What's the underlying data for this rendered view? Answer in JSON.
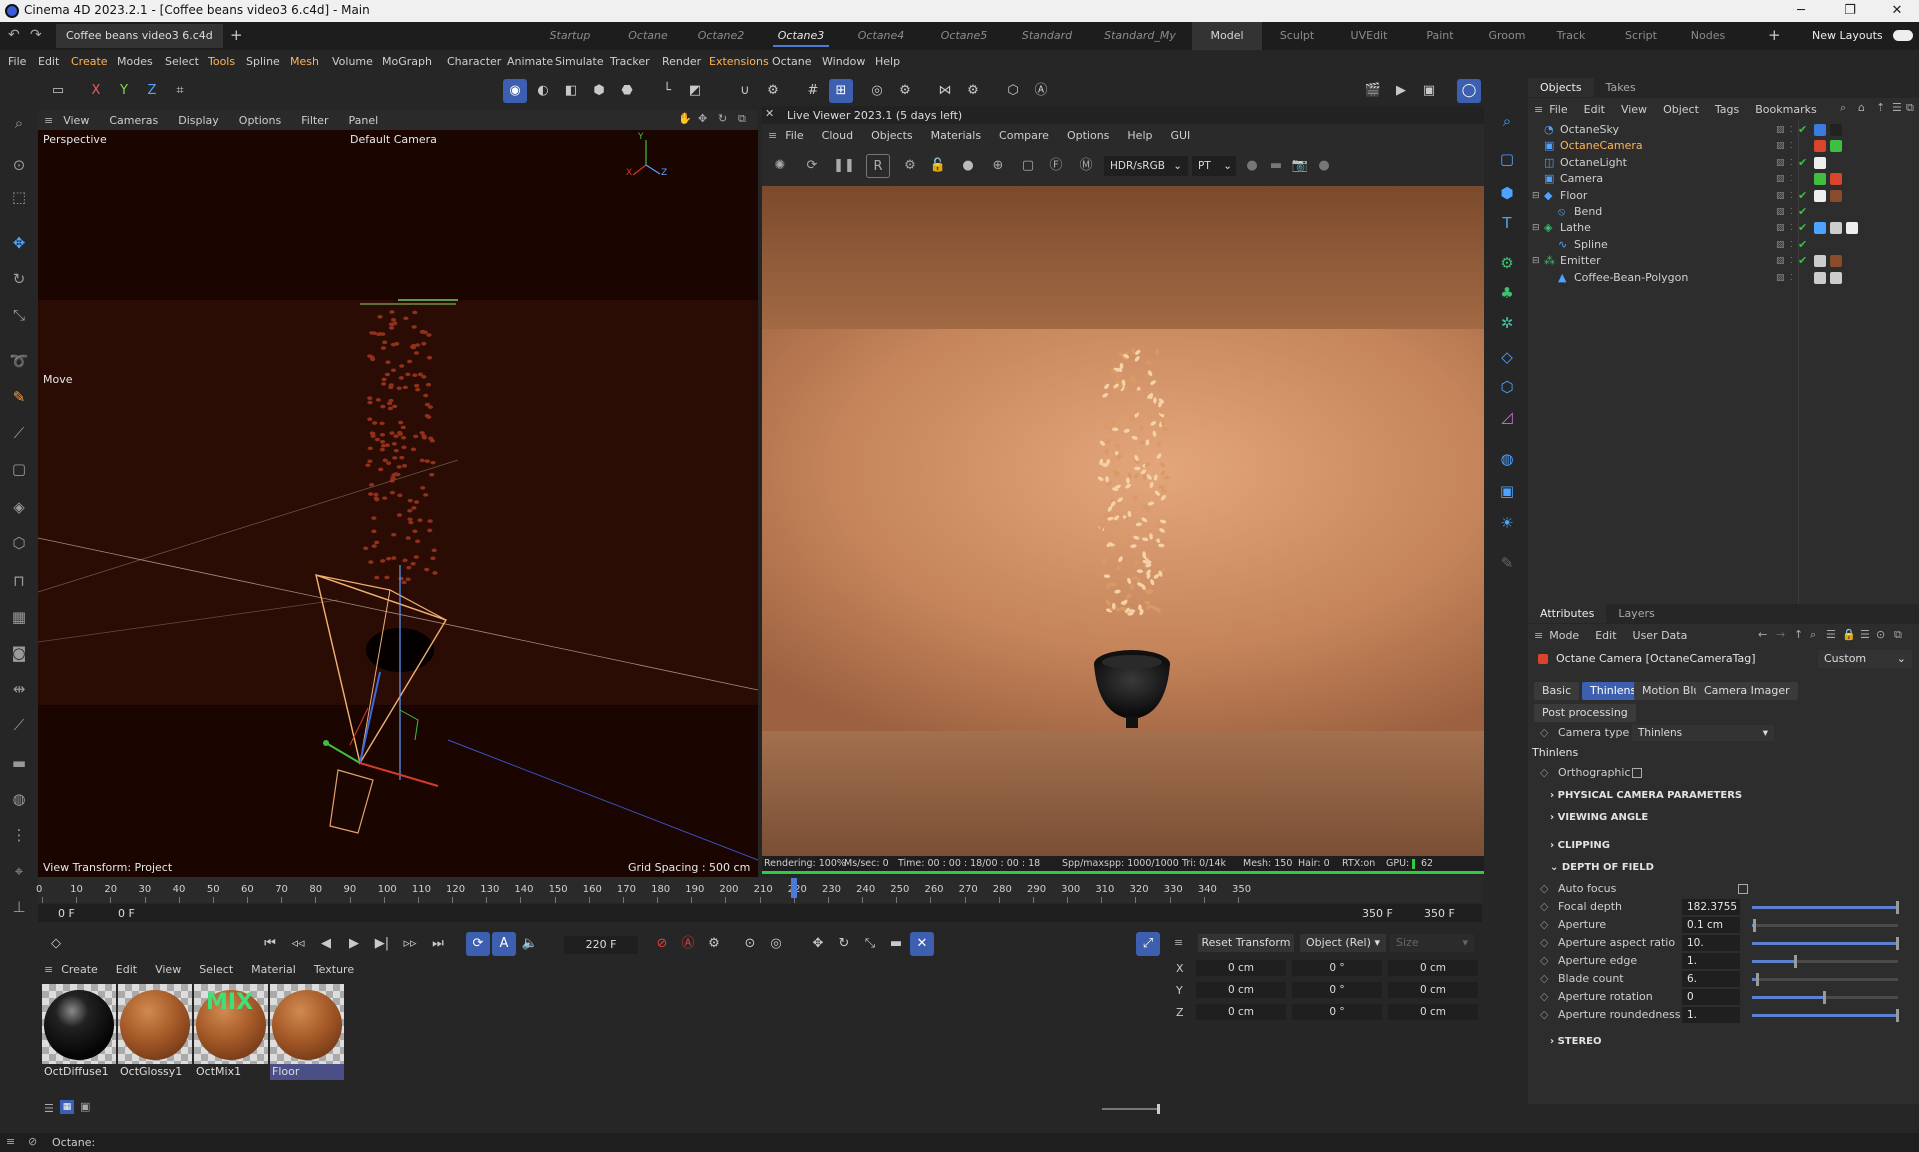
{
  "window": {
    "title": "Cinema 4D 2023.2.1 - [Coffee beans video3 6.c4d] - Main",
    "minimize": "─",
    "maximize": "❐",
    "close": "✕"
  },
  "doc_tab": "Coffee beans video3 6.c4d",
  "layouts": [
    "Startup",
    "Octane",
    "Octane2",
    "Octane3",
    "Octane4",
    "Octane5",
    "Standard",
    "Standard_My",
    "Model",
    "Sculpt",
    "UVEdit",
    "Paint",
    "Groom",
    "Track",
    "Script",
    "Nodes"
  ],
  "layouts_active": "Octane3",
  "new_layouts": "New Layouts",
  "menu": [
    "File",
    "Edit",
    "Create",
    "Modes",
    "Select",
    "Tools",
    "Spline",
    "Mesh",
    "Volume",
    "MoGraph",
    "Character",
    "Animate",
    "Simulate",
    "Tracker",
    "Render",
    "Extensions",
    "Octane",
    "Window",
    "Help"
  ],
  "axis_buttons": [
    "X",
    "Y",
    "Z"
  ],
  "viewport": {
    "menu": [
      "View",
      "Cameras",
      "Display",
      "Options",
      "Filter",
      "Panel"
    ],
    "label": "Perspective",
    "camera": "Default Camera",
    "tool_label": "Move",
    "bottom_left": "View Transform: Project",
    "bottom_right": "Grid Spacing : 500 cm",
    "axis_x": "X",
    "axis_y": "Y",
    "axis_z": "Z"
  },
  "live_viewer": {
    "title": "Live Viewer 2023.1 (5 days left)",
    "menu": [
      "File",
      "Cloud",
      "Objects",
      "Materials",
      "Compare",
      "Options",
      "Help",
      "GUI"
    ],
    "colorspace": "HDR/sRGB",
    "kernel": "PT",
    "status": {
      "rendering": "Rendering: 100%",
      "ms": "Ms/sec: 0",
      "time": "Time: 00 : 00 : 18/00 : 00 : 18",
      "spp": "Spp/maxspp: 1000/1000",
      "tri": "Tri: 0/14k",
      "mesh": "Mesh: 150",
      "hair": "Hair: 0",
      "rtx": "RTX:on",
      "gpu": "GPU:",
      "gpu_val": "62"
    },
    "progress": 1.0
  },
  "objects_panel": {
    "tabs": [
      "Objects",
      "Takes"
    ],
    "menu": [
      "File",
      "Edit",
      "View",
      "Object",
      "Tags",
      "Bookmarks"
    ],
    "items": [
      {
        "name": "OctaneSky",
        "indent": 0,
        "icon": "sky-icon",
        "highlight": false
      },
      {
        "name": "OctaneCamera",
        "indent": 0,
        "icon": "camera-icon",
        "highlight": true
      },
      {
        "name": "OctaneLight",
        "indent": 0,
        "icon": "light-icon",
        "highlight": false
      },
      {
        "name": "Camera",
        "indent": 0,
        "icon": "camera-icon",
        "highlight": false
      },
      {
        "name": "Floor",
        "indent": 0,
        "icon": "floor-icon",
        "highlight": false
      },
      {
        "name": "Bend",
        "indent": 1,
        "icon": "bend-icon",
        "highlight": false
      },
      {
        "name": "Lathe",
        "indent": 0,
        "icon": "lathe-icon",
        "highlight": false
      },
      {
        "name": "Spline",
        "indent": 1,
        "icon": "spline-icon",
        "highlight": false
      },
      {
        "name": "Emitter",
        "indent": 0,
        "icon": "emitter-icon",
        "highlight": false
      },
      {
        "name": "Coffee-Bean-Polygon",
        "indent": 1,
        "icon": "polygon-icon",
        "highlight": false
      }
    ]
  },
  "attributes": {
    "tabs": [
      "Attributes",
      "Layers"
    ],
    "menu": [
      "Mode",
      "Edit",
      "User Data"
    ],
    "object_title": "Octane Camera [OctaneCameraTag]",
    "preset": "Custom",
    "subtabs": [
      "Basic",
      "Thinlens",
      "Motion Blur",
      "Camera Imager"
    ],
    "subtab_active": "Thinlens",
    "post_processing": "Post processing",
    "camera_type_label": "Camera type",
    "camera_type_value": "Thinlens",
    "group_title": "Thinlens",
    "orthographic": "Orthographic",
    "sections": [
      "PHYSICAL CAMERA PARAMETERS",
      "VIEWING ANGLE",
      "CLIPPING",
      "DEPTH OF FIELD",
      "STEREO"
    ],
    "dof": [
      {
        "label": "Auto focus",
        "value": "",
        "checkbox": true,
        "level": null
      },
      {
        "label": "Focal depth",
        "value": "182.3755",
        "level": 1.0
      },
      {
        "label": "Aperture",
        "value": "0.1 cm",
        "level": 0.02
      },
      {
        "label": "Aperture aspect ratio",
        "value": "10.",
        "level": 1.0
      },
      {
        "label": "Aperture edge",
        "value": "1.",
        "level": 0.3
      },
      {
        "label": "Blade count",
        "value": "6.",
        "level": 0.04
      },
      {
        "label": "Aperture rotation",
        "value": "0",
        "level": 0.5
      },
      {
        "label": "Aperture roundedness",
        "value": "1.",
        "level": 1.0
      }
    ]
  },
  "timeline": {
    "ticks": [
      "0",
      "10",
      "20",
      "30",
      "40",
      "50",
      "60",
      "70",
      "80",
      "90",
      "100",
      "110",
      "120",
      "130",
      "140",
      "150",
      "160",
      "170",
      "180",
      "190",
      "200",
      "210",
      "220",
      "230",
      "240",
      "250",
      "260",
      "270",
      "280",
      "290",
      "300",
      "310",
      "320",
      "330",
      "340",
      "350"
    ],
    "start_field": "0 F",
    "start_field2": "0 F",
    "end_field": "350 F",
    "end_field2": "350 F",
    "current_frame": "220 F",
    "playhead_frame": 220,
    "max_frame": 350
  },
  "material_panel": {
    "menu": [
      "Create",
      "Edit",
      "View",
      "Select",
      "Material",
      "Texture"
    ],
    "materials": [
      {
        "name": "OctDiffuse1",
        "kind": "black"
      },
      {
        "name": "OctGlossy1",
        "kind": "brown"
      },
      {
        "name": "OctMix1",
        "kind": "mix",
        "badge": "MIX"
      },
      {
        "name": "Floor",
        "kind": "brown",
        "selected": true
      }
    ]
  },
  "coord_panel": {
    "reset": "Reset Transform",
    "mode": "Object (Rel)",
    "size": "Size",
    "rows": [
      {
        "axis": "X",
        "p": "0 cm",
        "r": "0 °",
        "s": "0 cm"
      },
      {
        "axis": "Y",
        "p": "0 cm",
        "r": "0 °",
        "s": "0 cm"
      },
      {
        "axis": "Z",
        "p": "0 cm",
        "r": "0 °",
        "s": "0 cm"
      }
    ]
  },
  "status_bar": "Octane:",
  "colors": {
    "accent": "#3d5fb0",
    "highlight": "#ffb35a",
    "progress": "#2ecc40"
  }
}
